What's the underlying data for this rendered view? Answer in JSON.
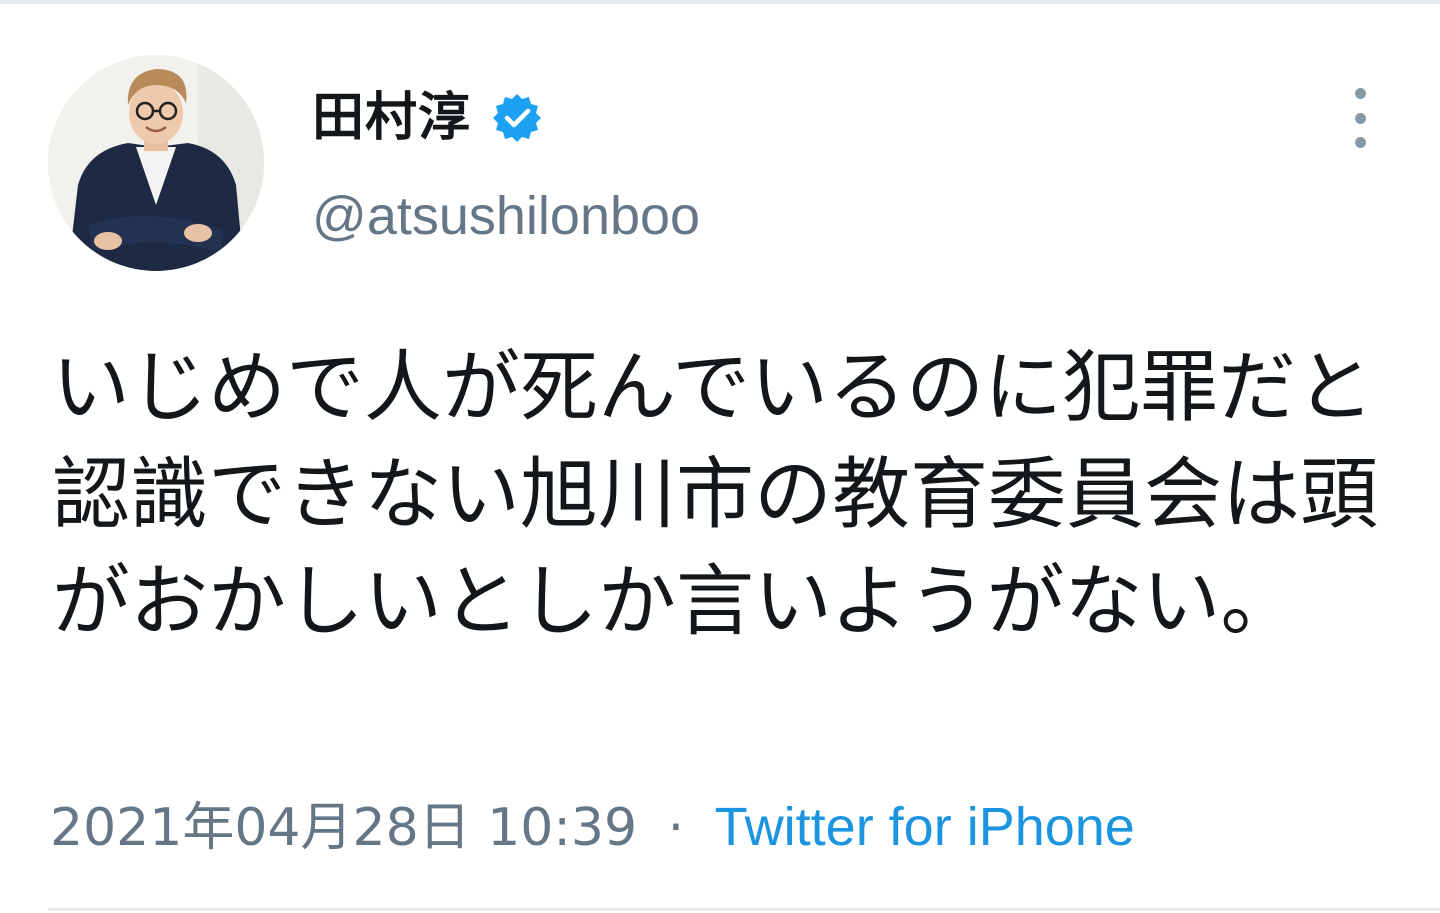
{
  "tweet": {
    "author": {
      "display_name": "田村淳",
      "handle": "@atsushilonboo",
      "verified": true,
      "verified_icon": "verified-badge-icon",
      "avatar_icon": "profile-photo"
    },
    "text": "いじめで人が死んでいるのに犯罪だと認識できない旭川市の教育委員会は頭がおかしいとしか言いようがない。",
    "timestamp": "2021年04月28日 10:39",
    "separator": "·",
    "source": "Twitter for iPhone",
    "menu_icon": "more-vertical-icon"
  },
  "colors": {
    "text_primary": "#14171a",
    "text_secondary": "#657786",
    "link": "#1b95e0",
    "verified": "#1da1f2"
  }
}
